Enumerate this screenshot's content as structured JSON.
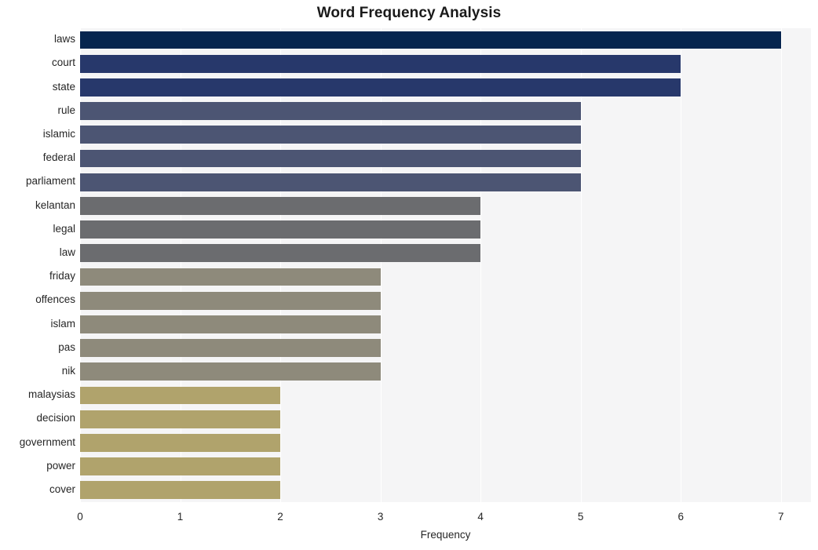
{
  "chart_data": {
    "type": "bar",
    "orientation": "horizontal",
    "title": "Word Frequency Analysis",
    "xlabel": "Frequency",
    "ylabel": "",
    "xlim": [
      0,
      7.3
    ],
    "xticks": [
      0,
      1,
      2,
      3,
      4,
      5,
      6,
      7
    ],
    "xtick_labels": [
      "0",
      "1",
      "2",
      "3",
      "4",
      "5",
      "6",
      "7"
    ],
    "grid": "vertical-white-on-light-gray",
    "legend": "none",
    "plot_background": "#f5f5f6",
    "figure_background": "#ffffff",
    "categories": [
      "laws",
      "court",
      "state",
      "rule",
      "islamic",
      "federal",
      "parliament",
      "kelantan",
      "legal",
      "law",
      "friday",
      "offences",
      "islam",
      "pas",
      "nik",
      "malaysias",
      "decision",
      "government",
      "power",
      "cover"
    ],
    "values": [
      7,
      6,
      6,
      5,
      5,
      5,
      5,
      4,
      4,
      4,
      3,
      3,
      3,
      3,
      3,
      2,
      2,
      2,
      2,
      2
    ],
    "bar_colors": [
      "#06254f",
      "#27386b",
      "#27386b",
      "#4c5573",
      "#4c5573",
      "#4c5573",
      "#4c5573",
      "#6b6c6f",
      "#6b6c6f",
      "#6b6c6f",
      "#8e8a7b",
      "#8e8a7b",
      "#8e8a7b",
      "#8e8a7b",
      "#8e8a7b",
      "#b0a36c",
      "#b0a36c",
      "#b0a36c",
      "#b0a36c",
      "#b0a36c"
    ],
    "bars": [
      {
        "label": "laws",
        "value": 7,
        "color": "#06254f"
      },
      {
        "label": "court",
        "value": 6,
        "color": "#27386b"
      },
      {
        "label": "state",
        "value": 6,
        "color": "#27386b"
      },
      {
        "label": "rule",
        "value": 5,
        "color": "#4c5573"
      },
      {
        "label": "islamic",
        "value": 5,
        "color": "#4c5573"
      },
      {
        "label": "federal",
        "value": 5,
        "color": "#4c5573"
      },
      {
        "label": "parliament",
        "value": 5,
        "color": "#4c5573"
      },
      {
        "label": "kelantan",
        "value": 4,
        "color": "#6b6c6f"
      },
      {
        "label": "legal",
        "value": 4,
        "color": "#6b6c6f"
      },
      {
        "label": "law",
        "value": 4,
        "color": "#6b6c6f"
      },
      {
        "label": "friday",
        "value": 3,
        "color": "#8e8a7b"
      },
      {
        "label": "offences",
        "value": 3,
        "color": "#8e8a7b"
      },
      {
        "label": "islam",
        "value": 3,
        "color": "#8e8a7b"
      },
      {
        "label": "pas",
        "value": 3,
        "color": "#8e8a7b"
      },
      {
        "label": "nik",
        "value": 3,
        "color": "#8e8a7b"
      },
      {
        "label": "malaysias",
        "value": 2,
        "color": "#b0a36c"
      },
      {
        "label": "decision",
        "value": 2,
        "color": "#b0a36c"
      },
      {
        "label": "government",
        "value": 2,
        "color": "#b0a36c"
      },
      {
        "label": "power",
        "value": 2,
        "color": "#b0a36c"
      },
      {
        "label": "cover",
        "value": 2,
        "color": "#b0a36c"
      }
    ]
  }
}
